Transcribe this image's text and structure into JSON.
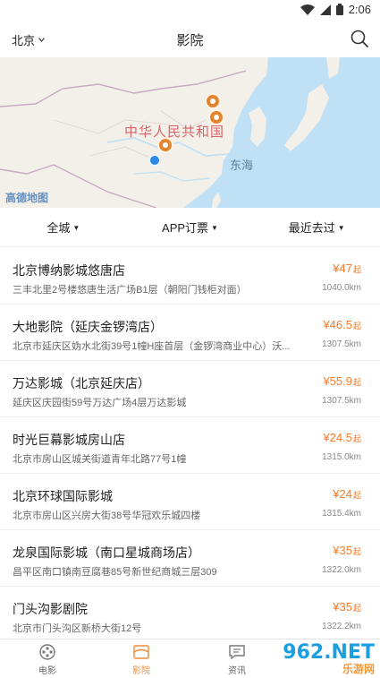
{
  "status_bar": {
    "time": "2:06",
    "icons": [
      "wifi-icon",
      "signal-icon",
      "battery-icon"
    ]
  },
  "header": {
    "city": "北京",
    "title": "影院",
    "search_icon": "search-icon"
  },
  "map": {
    "country_label": "中华人民共和国",
    "sea_label": "东海",
    "logo_text": "高德地图"
  },
  "filters": [
    {
      "label": "全城"
    },
    {
      "label": "APP订票"
    },
    {
      "label": "最近去过"
    }
  ],
  "cinemas": [
    {
      "name": "北京博纳影城悠唐店",
      "address": "三丰北里2号楼悠唐生活广场B1层（朝阳门钱柜对面）",
      "price": "¥47",
      "price_suffix": "起",
      "distance": "1040.0km"
    },
    {
      "name": "大地影院（延庆金锣湾店）",
      "address": "北京市延庆区妫水北街39号1幢H座首层（金锣湾商业中心）沃...",
      "price": "¥46.5",
      "price_suffix": "起",
      "distance": "1307.5km"
    },
    {
      "name": "万达影城（北京延庆店）",
      "address": "延庆区庆园街59号万达广场4层万达影城",
      "price": "¥55.9",
      "price_suffix": "起",
      "distance": "1307.5km"
    },
    {
      "name": "时光巨幕影城房山店",
      "address": "北京市房山区城关街道青年北路77号1幢",
      "price": "¥24.5",
      "price_suffix": "起",
      "distance": "1315.0km"
    },
    {
      "name": "北京环球国际影城",
      "address": "北京市房山区兴房大街38号华冠欢乐城四楼",
      "price": "¥24",
      "price_suffix": "起",
      "distance": "1315.4km"
    },
    {
      "name": "龙泉国际影城（南口星城商场店）",
      "address": "昌平区南口镇南豆腐巷85号新世纪商城三层309",
      "price": "¥35",
      "price_suffix": "起",
      "distance": "1322.0km"
    },
    {
      "name": "门头沟影剧院",
      "address": "北京市门头沟区新桥大街12号",
      "price": "¥35",
      "price_suffix": "起",
      "distance": "1322.2km"
    }
  ],
  "tabs": [
    {
      "label": "电影",
      "icon": "film-reel-icon",
      "active": false
    },
    {
      "label": "影院",
      "icon": "cinema-screen-icon",
      "active": true
    },
    {
      "label": "资讯",
      "icon": "news-chat-icon",
      "active": false
    }
  ],
  "watermark": {
    "main": "962.NET",
    "sub": "乐游网"
  },
  "colors": {
    "accent": "#f08a3a",
    "price": "#f27b2a",
    "map_water": "#bfe0f5",
    "map_land": "#f3efe9"
  }
}
